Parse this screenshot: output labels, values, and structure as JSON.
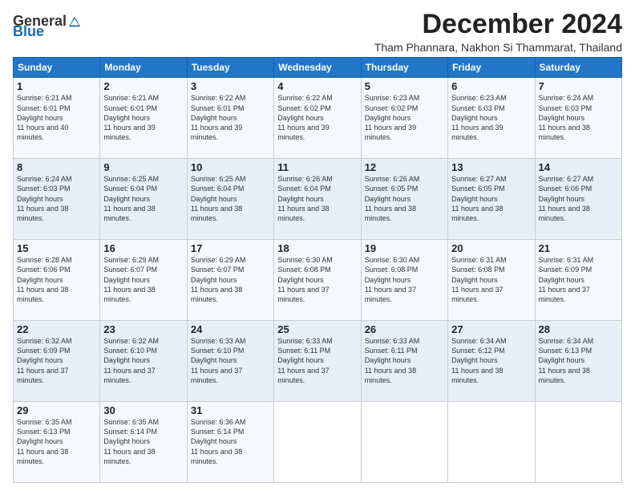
{
  "header": {
    "logo_general": "General",
    "logo_blue": "Blue",
    "main_title": "December 2024",
    "sub_title": "Tham Phannara, Nakhon Si Thammarat, Thailand"
  },
  "calendar": {
    "days_of_week": [
      "Sunday",
      "Monday",
      "Tuesday",
      "Wednesday",
      "Thursday",
      "Friday",
      "Saturday"
    ],
    "weeks": [
      [
        null,
        {
          "day": "2",
          "rise": "6:21 AM",
          "set": "6:01 PM",
          "hours": "11 hours and 39 minutes."
        },
        {
          "day": "3",
          "rise": "6:22 AM",
          "set": "6:01 PM",
          "hours": "11 hours and 39 minutes."
        },
        {
          "day": "4",
          "rise": "6:22 AM",
          "set": "6:02 PM",
          "hours": "11 hours and 39 minutes."
        },
        {
          "day": "5",
          "rise": "6:23 AM",
          "set": "6:02 PM",
          "hours": "11 hours and 39 minutes."
        },
        {
          "day": "6",
          "rise": "6:23 AM",
          "set": "6:03 PM",
          "hours": "11 hours and 39 minutes."
        },
        {
          "day": "7",
          "rise": "6:24 AM",
          "set": "6:03 PM",
          "hours": "11 hours and 38 minutes."
        }
      ],
      [
        {
          "day": "1",
          "rise": "6:21 AM",
          "set": "6:01 PM",
          "hours": "11 hours and 40 minutes."
        },
        {
          "day": "8",
          "rise": "6:24 AM",
          "set": "6:03 PM",
          "hours": "11 hours and 38 minutes."
        },
        {
          "day": "9",
          "rise": "6:25 AM",
          "set": "6:04 PM",
          "hours": "11 hours and 38 minutes."
        },
        {
          "day": "10",
          "rise": "6:25 AM",
          "set": "6:04 PM",
          "hours": "11 hours and 38 minutes."
        },
        {
          "day": "11",
          "rise": "6:26 AM",
          "set": "6:04 PM",
          "hours": "11 hours and 38 minutes."
        },
        {
          "day": "12",
          "rise": "6:26 AM",
          "set": "6:05 PM",
          "hours": "11 hours and 38 minutes."
        },
        {
          "day": "13",
          "rise": "6:27 AM",
          "set": "6:05 PM",
          "hours": "11 hours and 38 minutes."
        }
      ],
      [
        {
          "day": "14",
          "rise": "6:27 AM",
          "set": "6:06 PM",
          "hours": "11 hours and 38 minutes."
        },
        {
          "day": "15",
          "rise": "6:28 AM",
          "set": "6:06 PM",
          "hours": "11 hours and 38 minutes."
        },
        {
          "day": "16",
          "rise": "6:29 AM",
          "set": "6:07 PM",
          "hours": "11 hours and 38 minutes."
        },
        {
          "day": "17",
          "rise": "6:29 AM",
          "set": "6:07 PM",
          "hours": "11 hours and 38 minutes."
        },
        {
          "day": "18",
          "rise": "6:30 AM",
          "set": "6:08 PM",
          "hours": "11 hours and 37 minutes."
        },
        {
          "day": "19",
          "rise": "6:30 AM",
          "set": "6:08 PM",
          "hours": "11 hours and 37 minutes."
        },
        {
          "day": "20",
          "rise": "6:31 AM",
          "set": "6:08 PM",
          "hours": "11 hours and 37 minutes."
        }
      ],
      [
        {
          "day": "21",
          "rise": "6:31 AM",
          "set": "6:09 PM",
          "hours": "11 hours and 37 minutes."
        },
        {
          "day": "22",
          "rise": "6:32 AM",
          "set": "6:09 PM",
          "hours": "11 hours and 37 minutes."
        },
        {
          "day": "23",
          "rise": "6:32 AM",
          "set": "6:10 PM",
          "hours": "11 hours and 37 minutes."
        },
        {
          "day": "24",
          "rise": "6:33 AM",
          "set": "6:10 PM",
          "hours": "11 hours and 37 minutes."
        },
        {
          "day": "25",
          "rise": "6:33 AM",
          "set": "6:11 PM",
          "hours": "11 hours and 37 minutes."
        },
        {
          "day": "26",
          "rise": "6:33 AM",
          "set": "6:11 PM",
          "hours": "11 hours and 38 minutes."
        },
        {
          "day": "27",
          "rise": "6:34 AM",
          "set": "6:12 PM",
          "hours": "11 hours and 38 minutes."
        }
      ],
      [
        {
          "day": "28",
          "rise": "6:34 AM",
          "set": "6:13 PM",
          "hours": "11 hours and 38 minutes."
        },
        {
          "day": "29",
          "rise": "6:35 AM",
          "set": "6:13 PM",
          "hours": "11 hours and 38 minutes."
        },
        {
          "day": "30",
          "rise": "6:35 AM",
          "set": "6:14 PM",
          "hours": "11 hours and 38 minutes."
        },
        {
          "day": "31",
          "rise": "6:36 AM",
          "set": "6:14 PM",
          "hours": "11 hours and 38 minutes."
        },
        null,
        null,
        null
      ]
    ]
  }
}
